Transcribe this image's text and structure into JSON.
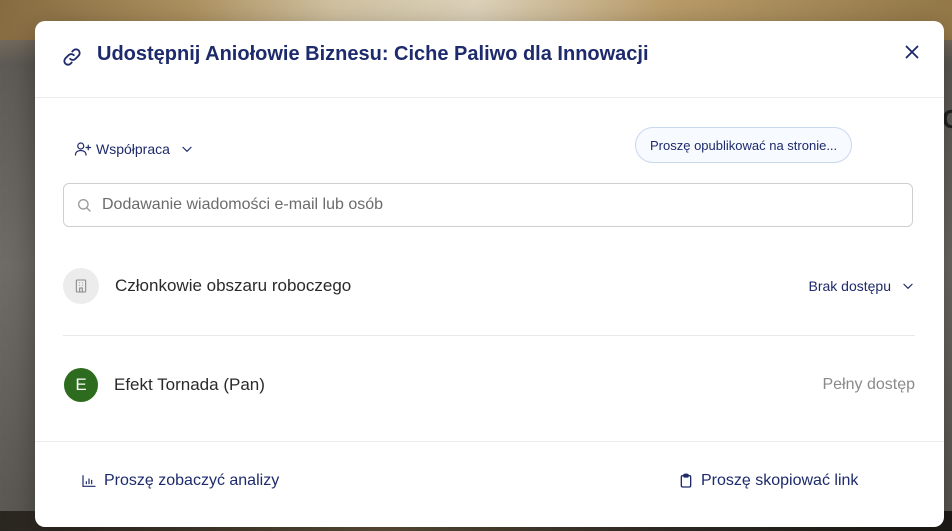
{
  "background": {
    "edge_text": "C"
  },
  "modal": {
    "title": "Udostępnij Aniołowie Biznesu: Ciche Paliwo dla Innowacji",
    "icons": {
      "title": "link-icon",
      "close": "close-icon"
    }
  },
  "permission": {
    "label": "Współpraca",
    "icon": "add-user-icon"
  },
  "publish_button": {
    "label": "Proszę opublikować na stronie..."
  },
  "search": {
    "placeholder": "Dodawanie wiadomości e-mail lub osób",
    "value": ""
  },
  "members": [
    {
      "name": "Członkowie obszaru roboczego",
      "access": "Brak dostępu",
      "icon": "workspace-building-icon"
    },
    {
      "name": "Efekt Tornada (Pan)",
      "access": "Pełny dostęp",
      "avatar_letter": "E",
      "avatar_color": "#2d6b1e"
    }
  ],
  "footer": {
    "analytics_label": "Proszę zobaczyć analizy",
    "copy_link_label": "Proszę skopiować link"
  },
  "colors": {
    "accent": "#1d2a6b",
    "border": "#cfcfcf"
  }
}
